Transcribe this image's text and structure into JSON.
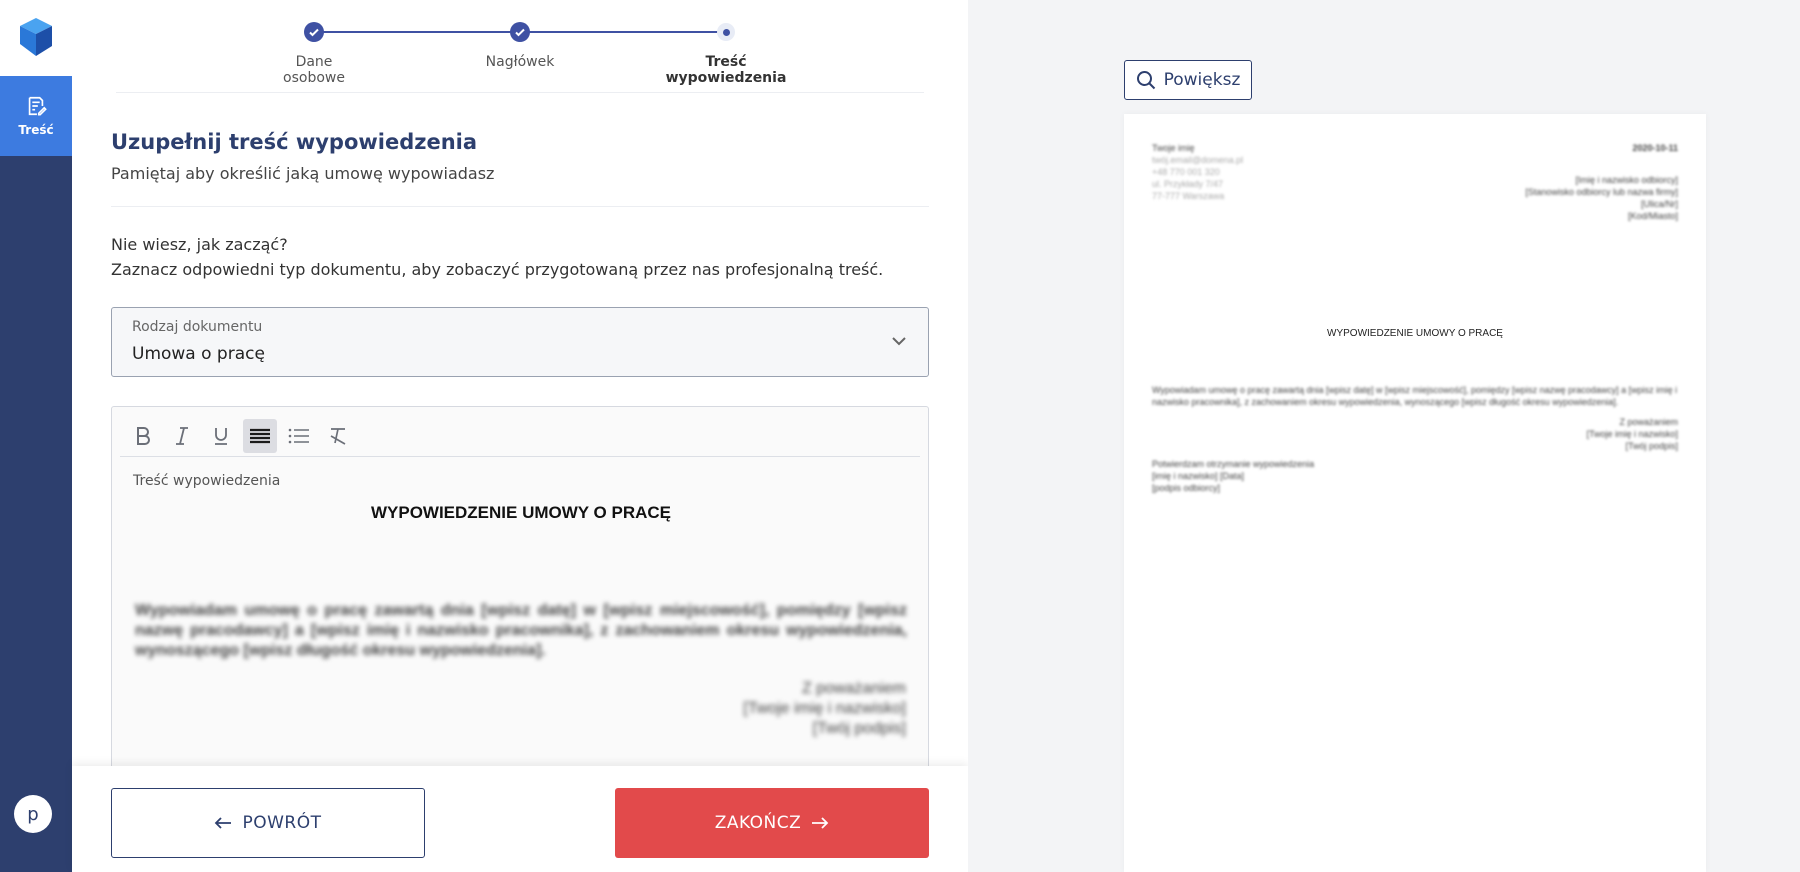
{
  "sidebar": {
    "nav": [
      {
        "label": "Treść",
        "icon": "edit-document-icon"
      }
    ],
    "avatar_initial": "p"
  },
  "stepper": {
    "steps": [
      {
        "label_line1": "Dane",
        "label_line2": "osobowe",
        "status": "done"
      },
      {
        "label_line1": "Nagłówek",
        "label_line2": "",
        "status": "done"
      },
      {
        "label_line1": "Treść",
        "label_line2": "wypowiedzenia",
        "status": "current"
      }
    ]
  },
  "form": {
    "title": "Uzupełnij treść wypowiedzenia",
    "subtitle": "Pamiętaj aby określić jaką umowę wypowiadasz",
    "help_line1": "Nie wiesz, jak zacząć?",
    "help_line2": "Zaznacz odpowiedni typ dokumentu, aby zobaczyć przygotowaną przez nas profesjonalną treść.",
    "doc_type": {
      "label": "Rodzaj dokumentu",
      "value": "Umowa o pracę"
    }
  },
  "editor": {
    "toolbar": [
      "bold-icon",
      "italic-icon",
      "underline-icon",
      "align-justify-icon",
      "bullet-list-icon",
      "clear-format-icon"
    ],
    "active_tool": "align-justify-icon",
    "field_label": "Treść wypowiedzenia",
    "heading": "WYPOWIEDZENIE UMOWY O PRACĘ",
    "body": "Wypowiadam umowę o pracę zawartą dnia [wpisz datę] w [wpisz miejscowość], pomiędzy [wpisz nazwę pracodawcy] a [wpisz imię i nazwisko pracownika], z zachowaniem okresu wypowiedzenia, wynoszącego [wpisz długość okresu wypowiedzenia].",
    "closing": "Z poważaniem",
    "name_placeholder": "[Twoje imię i nazwisko]",
    "signature_placeholder": "[Twój podpis]"
  },
  "buttons": {
    "back": "POWRÓT",
    "finish": "ZAKOŃCZ"
  },
  "preview": {
    "zoom_label": "Powiększ",
    "sender": [
      "Twoje imię",
      "twój.email@domena.pl",
      "+48 770 001 320",
      "ul. Przykłady 7/47",
      "77-777 Warszawa"
    ],
    "date": "2020-10-11",
    "recipient": [
      "[Imię i nazwisko odbiorcy]",
      "[Stanowisko odbiorcy lub nazwa firmy]",
      "[Ulica/Nr]",
      "[Kod/Miasto]"
    ],
    "heading": "WYPOWIEDZENIE UMOWY O PRACĘ",
    "body": "Wypowiadam umowę o pracę zawartą dnia [wpisz datę] w [wpisz miejscowość], pomiędzy [wpisz nazwę pracodawcy] a [wpisz imię i nazwisko pracownika], z zachowaniem okresu wypowiedzenia, wynoszącego [wpisz długość okresu wypowiedzenia].",
    "closing": "Z poważaniem",
    "name_placeholder": "[Twoje imię i nazwisko]",
    "signature_placeholder": "[Twój podpis]",
    "ack": [
      "Potwierdzam otrzymanie wypowiedzenia",
      "[imię i nazwisko] [Data]",
      "[podpis odbiorcy]"
    ]
  }
}
